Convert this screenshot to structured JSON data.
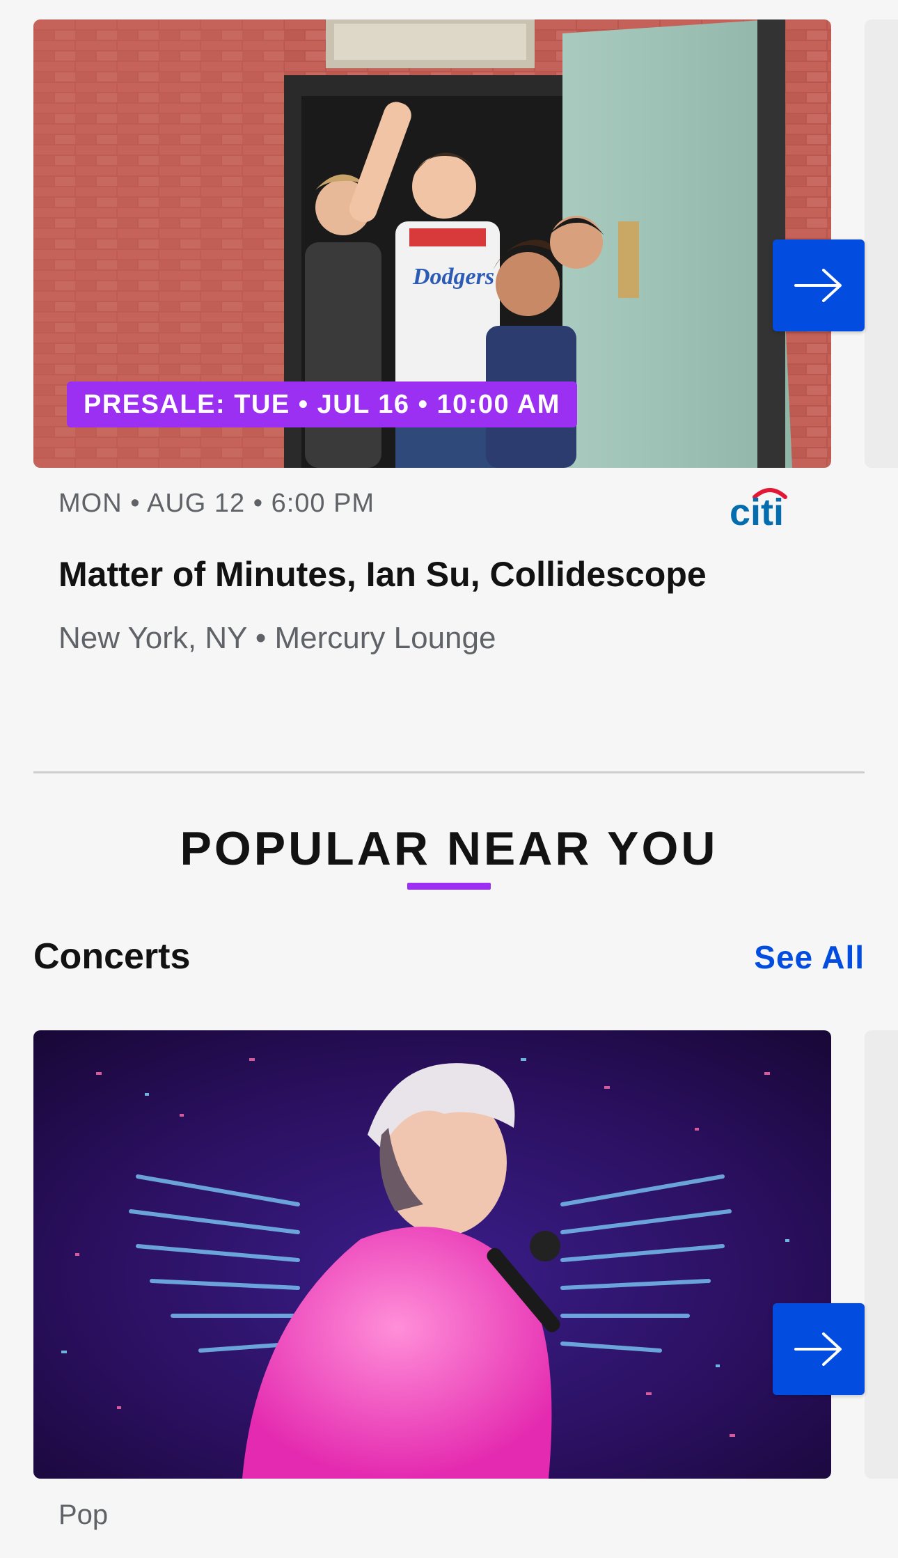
{
  "featured_event": {
    "presale_badge": "PRESALE: TUE • JUL 16 • 10:00 AM",
    "date": "MON • AUG 12 • 6:00 PM",
    "sponsor_logo": "citi",
    "title": "Matter of Minutes, Ian Su, Collidescope",
    "venue": "New York, NY • Mercury Lounge",
    "next_icon": "arrow-right-icon"
  },
  "popular_section": {
    "heading": "POPULAR NEAR YOU"
  },
  "concerts": {
    "title": "Concerts",
    "see_all_label": "See All",
    "first_card_genre": "Pop",
    "next_icon": "arrow-right-icon"
  },
  "colors": {
    "accent_blue": "#024ddf",
    "presale_purple": "#9b30f3",
    "citi_blue": "#056dae",
    "citi_red": "#e31837"
  }
}
